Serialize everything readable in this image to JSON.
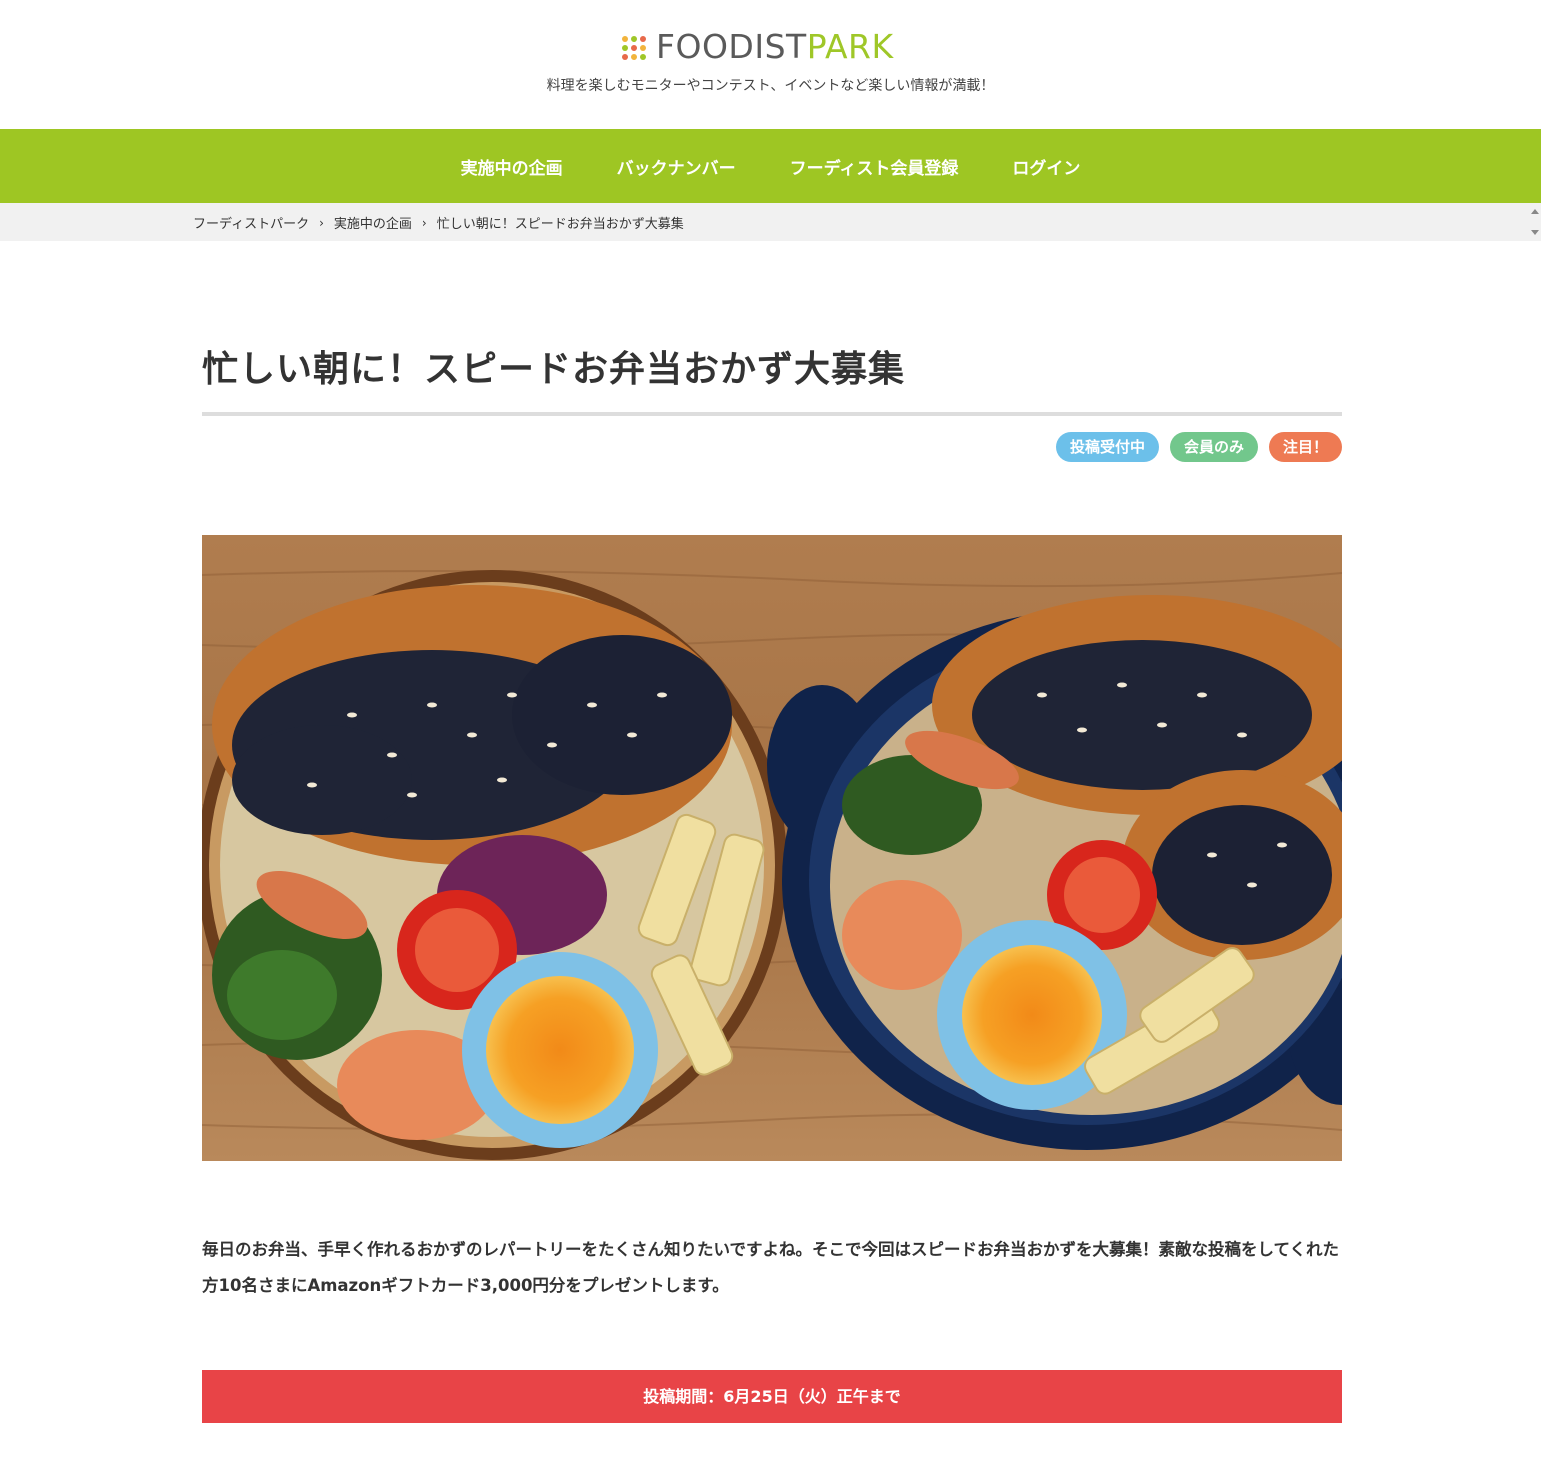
{
  "header": {
    "logo": {
      "word1": "FOODIST",
      "word2": "PARK",
      "icon": "grid-dots-icon"
    },
    "tagline": "料理を楽しむモニターやコンテスト、イベントなど楽しい情報が満載！"
  },
  "nav": {
    "items": [
      {
        "label": "実施中の企画"
      },
      {
        "label": "バックナンバー"
      },
      {
        "label": "フーディスト会員登録"
      },
      {
        "label": "ログイン"
      }
    ]
  },
  "breadcrumb": {
    "items": [
      {
        "label": "フーディストパーク"
      },
      {
        "label": "実施中の企画"
      },
      {
        "label": "忙しい朝に！スピードお弁当おかず大募集"
      }
    ],
    "separator": "›"
  },
  "article": {
    "title": "忙しい朝に！スピードお弁当おかず大募集",
    "badges": [
      {
        "label": "投稿受付中",
        "color": "#6cc0ea"
      },
      {
        "label": "会員のみ",
        "color": "#72c78c"
      },
      {
        "label": "注目！",
        "color": "#ee7a53"
      }
    ],
    "lead": "毎日のお弁当、手早く作れるおかずのレパートリーをたくさん知りたいですよね。そこで今回はスピードお弁当おかずを大募集！素敵な投稿をしてくれた方10名さまにAmazonギフトカード3,000円分をプレゼントします。",
    "period": "投稿期間：6月25日（火）正午まで"
  },
  "colors": {
    "nav_green": "#9ec623",
    "period_red": "#e84447",
    "logo_green": "#9fc728"
  }
}
